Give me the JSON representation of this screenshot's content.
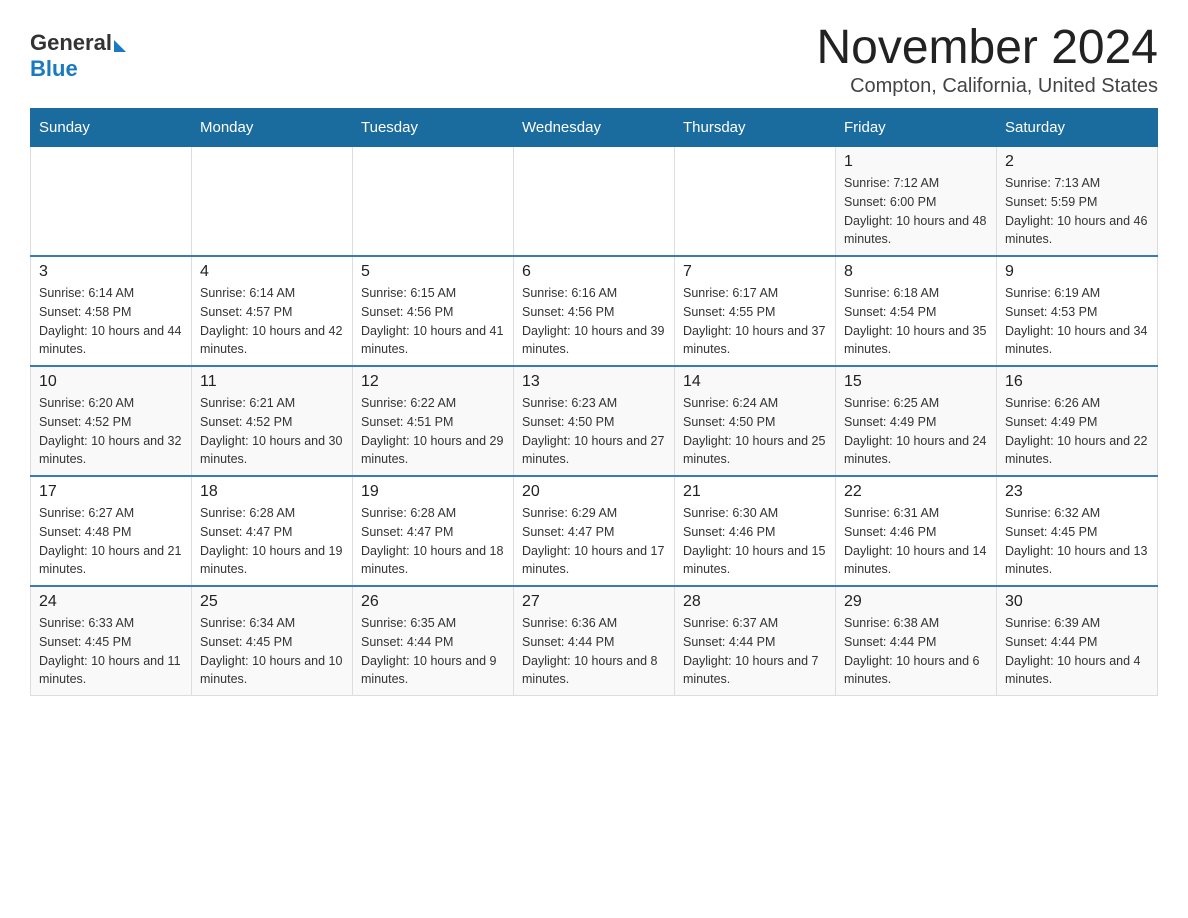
{
  "logo": {
    "general": "General",
    "blue": "Blue"
  },
  "title": "November 2024",
  "location": "Compton, California, United States",
  "weekdays": [
    "Sunday",
    "Monday",
    "Tuesday",
    "Wednesday",
    "Thursday",
    "Friday",
    "Saturday"
  ],
  "weeks": [
    [
      {
        "day": "",
        "info": ""
      },
      {
        "day": "",
        "info": ""
      },
      {
        "day": "",
        "info": ""
      },
      {
        "day": "",
        "info": ""
      },
      {
        "day": "",
        "info": ""
      },
      {
        "day": "1",
        "info": "Sunrise: 7:12 AM\nSunset: 6:00 PM\nDaylight: 10 hours and 48 minutes."
      },
      {
        "day": "2",
        "info": "Sunrise: 7:13 AM\nSunset: 5:59 PM\nDaylight: 10 hours and 46 minutes."
      }
    ],
    [
      {
        "day": "3",
        "info": "Sunrise: 6:14 AM\nSunset: 4:58 PM\nDaylight: 10 hours and 44 minutes."
      },
      {
        "day": "4",
        "info": "Sunrise: 6:14 AM\nSunset: 4:57 PM\nDaylight: 10 hours and 42 minutes."
      },
      {
        "day": "5",
        "info": "Sunrise: 6:15 AM\nSunset: 4:56 PM\nDaylight: 10 hours and 41 minutes."
      },
      {
        "day": "6",
        "info": "Sunrise: 6:16 AM\nSunset: 4:56 PM\nDaylight: 10 hours and 39 minutes."
      },
      {
        "day": "7",
        "info": "Sunrise: 6:17 AM\nSunset: 4:55 PM\nDaylight: 10 hours and 37 minutes."
      },
      {
        "day": "8",
        "info": "Sunrise: 6:18 AM\nSunset: 4:54 PM\nDaylight: 10 hours and 35 minutes."
      },
      {
        "day": "9",
        "info": "Sunrise: 6:19 AM\nSunset: 4:53 PM\nDaylight: 10 hours and 34 minutes."
      }
    ],
    [
      {
        "day": "10",
        "info": "Sunrise: 6:20 AM\nSunset: 4:52 PM\nDaylight: 10 hours and 32 minutes."
      },
      {
        "day": "11",
        "info": "Sunrise: 6:21 AM\nSunset: 4:52 PM\nDaylight: 10 hours and 30 minutes."
      },
      {
        "day": "12",
        "info": "Sunrise: 6:22 AM\nSunset: 4:51 PM\nDaylight: 10 hours and 29 minutes."
      },
      {
        "day": "13",
        "info": "Sunrise: 6:23 AM\nSunset: 4:50 PM\nDaylight: 10 hours and 27 minutes."
      },
      {
        "day": "14",
        "info": "Sunrise: 6:24 AM\nSunset: 4:50 PM\nDaylight: 10 hours and 25 minutes."
      },
      {
        "day": "15",
        "info": "Sunrise: 6:25 AM\nSunset: 4:49 PM\nDaylight: 10 hours and 24 minutes."
      },
      {
        "day": "16",
        "info": "Sunrise: 6:26 AM\nSunset: 4:49 PM\nDaylight: 10 hours and 22 minutes."
      }
    ],
    [
      {
        "day": "17",
        "info": "Sunrise: 6:27 AM\nSunset: 4:48 PM\nDaylight: 10 hours and 21 minutes."
      },
      {
        "day": "18",
        "info": "Sunrise: 6:28 AM\nSunset: 4:47 PM\nDaylight: 10 hours and 19 minutes."
      },
      {
        "day": "19",
        "info": "Sunrise: 6:28 AM\nSunset: 4:47 PM\nDaylight: 10 hours and 18 minutes."
      },
      {
        "day": "20",
        "info": "Sunrise: 6:29 AM\nSunset: 4:47 PM\nDaylight: 10 hours and 17 minutes."
      },
      {
        "day": "21",
        "info": "Sunrise: 6:30 AM\nSunset: 4:46 PM\nDaylight: 10 hours and 15 minutes."
      },
      {
        "day": "22",
        "info": "Sunrise: 6:31 AM\nSunset: 4:46 PM\nDaylight: 10 hours and 14 minutes."
      },
      {
        "day": "23",
        "info": "Sunrise: 6:32 AM\nSunset: 4:45 PM\nDaylight: 10 hours and 13 minutes."
      }
    ],
    [
      {
        "day": "24",
        "info": "Sunrise: 6:33 AM\nSunset: 4:45 PM\nDaylight: 10 hours and 11 minutes."
      },
      {
        "day": "25",
        "info": "Sunrise: 6:34 AM\nSunset: 4:45 PM\nDaylight: 10 hours and 10 minutes."
      },
      {
        "day": "26",
        "info": "Sunrise: 6:35 AM\nSunset: 4:44 PM\nDaylight: 10 hours and 9 minutes."
      },
      {
        "day": "27",
        "info": "Sunrise: 6:36 AM\nSunset: 4:44 PM\nDaylight: 10 hours and 8 minutes."
      },
      {
        "day": "28",
        "info": "Sunrise: 6:37 AM\nSunset: 4:44 PM\nDaylight: 10 hours and 7 minutes."
      },
      {
        "day": "29",
        "info": "Sunrise: 6:38 AM\nSunset: 4:44 PM\nDaylight: 10 hours and 6 minutes."
      },
      {
        "day": "30",
        "info": "Sunrise: 6:39 AM\nSunset: 4:44 PM\nDaylight: 10 hours and 4 minutes."
      }
    ]
  ]
}
